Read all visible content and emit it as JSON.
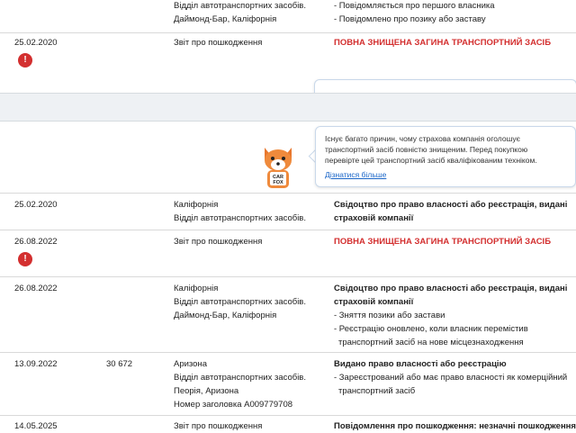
{
  "rows": [
    {
      "id": "r0",
      "source_lines": [
        "Відділ автотранспортних засобів.",
        "Даймонд-Бар, Каліфорнія"
      ],
      "comments_lines": [
        "- Повідомляється про першого власника",
        "- Повідомлено про позику або заставу"
      ]
    },
    {
      "id": "r1",
      "date": "25.02.2020",
      "source": "Звіт про пошкодження",
      "comment": "ПОВНА ЗНИЩЕНА ЗАГИНА ТРАНСПОРТНИЙ ЗАСІБ"
    },
    {
      "id": "r2",
      "date": "25.02.2020",
      "source_lines": [
        "Каліфорнія",
        "Відділ автотранспортних засобів."
      ],
      "comment_title_lines": [
        "Свідоцтво про право власності або реєстрація, видані",
        "страховій компанії"
      ]
    },
    {
      "id": "r3",
      "date": "26.08.2022",
      "source": "Звіт про пошкодження",
      "comment": "ПОВНА ЗНИЩЕНА ЗАГИНА ТРАНСПОРТНИЙ ЗАСІБ"
    },
    {
      "id": "r4",
      "date": "26.08.2022",
      "source_lines": [
        "Каліфорнія",
        "Відділ автотранспортних засобів.",
        "Даймонд-Бар, Каліфорнія"
      ],
      "comment_title_lines": [
        "Свідоцтво про право власності або реєстрація, видані",
        "страховій компанії"
      ],
      "comment_items": [
        [
          "- Зняття позики або застави"
        ],
        [
          "- Реєстрацію оновлено, коли власник перемістив",
          "транспортний засіб на нове місцезнаходження"
        ]
      ]
    },
    {
      "id": "r5",
      "date": "13.09.2022",
      "mileage": "30 672",
      "source_lines": [
        "Аризона",
        "Відділ автотранспортних засобів.",
        "Пеорія, Аризона",
        "Номер заголовка A009779708"
      ],
      "comment_title_lines": [
        "Видано право власності або реєстрацію"
      ],
      "comment_items": [
        [
          "- Зареєстрований або має право власності як комерційний",
          "транспортний засіб"
        ]
      ]
    },
    {
      "id": "r6",
      "date": "14.05.2025",
      "source": "Звіт про пошкодження",
      "comment": "Повідомлення про пошкодження: незначні пошкодження"
    }
  ],
  "tooltip": {
    "lines": [
      "Існує багато причин, чому страхова компанія оголошує",
      "транспортний засіб повністю знищеним. Перед покупкою",
      "перевірте цей транспортний засіб кваліфікованим техніком."
    ],
    "link": "Дізнатися більше"
  },
  "mascot": {
    "badge_line1": "CAR",
    "badge_line2": "FOX"
  },
  "colors": {
    "alert_red": "#d32f2f",
    "link_blue": "#1a66c8"
  }
}
